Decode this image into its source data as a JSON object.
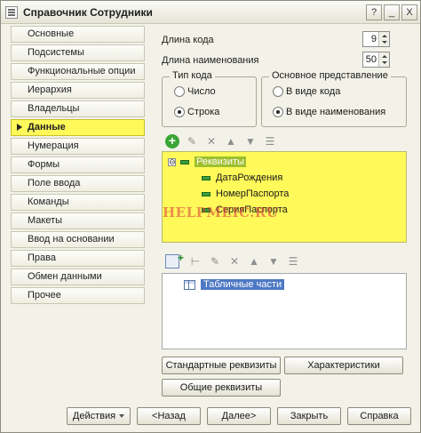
{
  "window": {
    "title": "Справочник Сотрудники"
  },
  "titlebar": {
    "help": "?",
    "minimize": "_",
    "close": "X"
  },
  "nav": {
    "items": [
      "Основные",
      "Подсистемы",
      "Функциональные опции",
      "Иерархия",
      "Владельцы",
      "Данные",
      "Нумерация",
      "Формы",
      "Поле ввода",
      "Команды",
      "Макеты",
      "Ввод на основании",
      "Права",
      "Обмен данными",
      "Прочее"
    ],
    "active_index": 5
  },
  "fields": {
    "code_length_label": "Длина кода",
    "code_length_value": "9",
    "name_length_label": "Длина наименования",
    "name_length_value": "50"
  },
  "code_type": {
    "title": "Тип кода",
    "option_number": "Число",
    "option_string": "Строка",
    "selected": "Строка"
  },
  "main_presentation": {
    "title": "Основное представление",
    "option_code": "В виде кода",
    "option_name": "В виде наименования",
    "selected": "В виде наименования"
  },
  "attributes_tree": {
    "root": "Реквизиты",
    "expander": "⊖",
    "children": [
      "ДатаРождения",
      "НомерПаспорта",
      "СерияПаспорта"
    ]
  },
  "watermark": "HELPMEIC.RU",
  "tabular_parts": {
    "root": "Табличные части"
  },
  "buttons": {
    "standard_attributes": "Стандартные реквизиты",
    "characteristics": "Характеристики",
    "common_attributes": "Общие реквизиты"
  },
  "footer": {
    "actions": "Действия",
    "back": "<Назад",
    "next": "Далее>",
    "close": "Закрыть",
    "help": "Справка"
  },
  "colors": {
    "highlight": "#fff95a",
    "selection": "#4e78c4",
    "background": "#f3f2e8"
  }
}
